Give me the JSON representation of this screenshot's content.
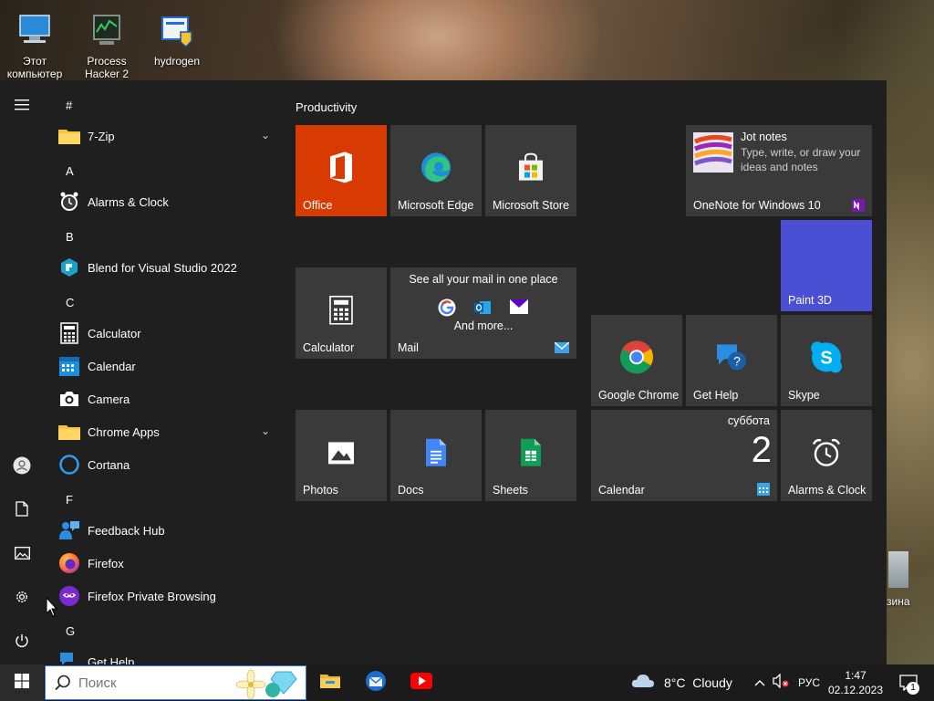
{
  "desktop": {
    "icons": [
      {
        "label": "Этот компьютер"
      },
      {
        "label": "Process Hacker 2"
      },
      {
        "label": "hydrogen"
      }
    ],
    "recycle_label": "зина"
  },
  "start_menu": {
    "sections": {
      "hash": "#",
      "a": "A",
      "b": "B",
      "c": "C",
      "f": "F",
      "g": "G"
    },
    "apps": {
      "zip": "7-Zip",
      "alarms": "Alarms & Clock",
      "blend": "Blend for Visual Studio 2022",
      "calculator": "Calculator",
      "calendar": "Calendar",
      "camera": "Camera",
      "chrome_apps": "Chrome Apps",
      "cortana": "Cortana",
      "feedback": "Feedback Hub",
      "firefox": "Firefox",
      "firefox_private": "Firefox Private Browsing",
      "get_help": "Get Help"
    },
    "group_title": "Productivity",
    "tiles": {
      "office": "Office",
      "edge": "Microsoft Edge",
      "store": "Microsoft Store",
      "onenote_title": "Jot notes",
      "onenote_desc": "Type, write, or draw your ideas and notes",
      "onenote": "OneNote for Windows 10",
      "paint3d": "Paint 3D",
      "calculator": "Calculator",
      "mail_heading": "See all your mail in one place",
      "mail_more": "And more...",
      "mail": "Mail",
      "chrome": "Google Chrome",
      "gethelp": "Get Help",
      "skype": "Skype",
      "photos": "Photos",
      "docs": "Docs",
      "sheets": "Sheets",
      "calendar_day_name": "суббота",
      "calendar_day": "2",
      "calendar": "Calendar",
      "alarms": "Alarms & Clock"
    }
  },
  "taskbar": {
    "search_placeholder": "Поиск",
    "weather": "8°C  Cloudy",
    "language": "РУС",
    "time": "1:47",
    "date": "02.12.2023",
    "notification_count": "1"
  },
  "colors": {
    "office": "#d83b01",
    "paint3d": "#4a4fd4",
    "tile": "#3a3a3a",
    "start_bg": "#1f1f1f"
  }
}
